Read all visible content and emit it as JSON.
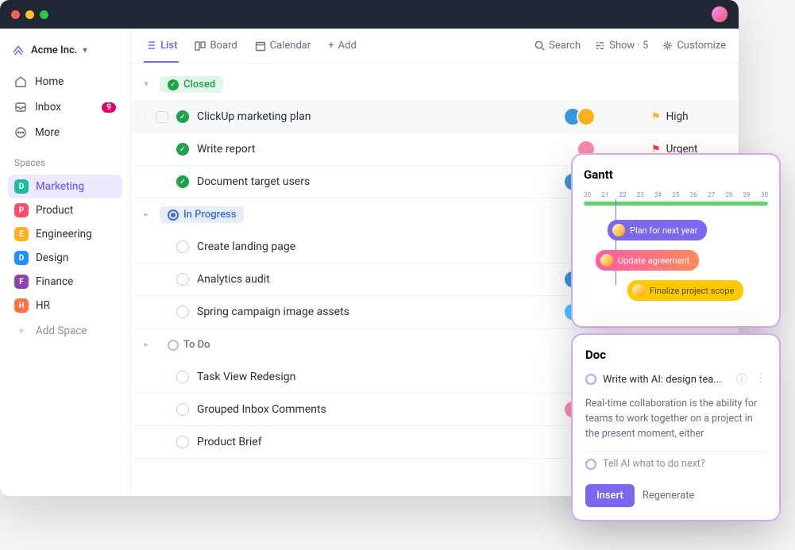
{
  "workspace": {
    "name": "Acme Inc."
  },
  "sidebar": {
    "nav": [
      {
        "label": "Home"
      },
      {
        "label": "Inbox",
        "badge": "9"
      },
      {
        "label": "More"
      }
    ],
    "spaces_label": "Spaces",
    "spaces": [
      {
        "letter": "D",
        "name": "Marketing",
        "color": "#1abc9c",
        "active": true
      },
      {
        "letter": "P",
        "name": "Product",
        "color": "#ff4d6a"
      },
      {
        "letter": "E",
        "name": "Engineering",
        "color": "#ffb020"
      },
      {
        "letter": "D",
        "name": "Design",
        "color": "#1e90ff"
      },
      {
        "letter": "F",
        "name": "Finance",
        "color": "#8e44ad"
      },
      {
        "letter": "H",
        "name": "HR",
        "color": "#ff7043"
      }
    ],
    "add_space": "Add Space"
  },
  "toolbar": {
    "views": {
      "list": "List",
      "board": "Board",
      "calendar": "Calendar",
      "add": "Add"
    },
    "search": "Search",
    "show": "Show · 5",
    "customize": "Customize"
  },
  "groups": [
    {
      "status": "Closed",
      "style": "closed",
      "tasks": [
        {
          "title": "ClickUp marketing plan",
          "status": "closed",
          "assignees": [
            "#3498db",
            "#ffb020"
          ],
          "priority": "High",
          "flag_color": "#ffb020",
          "highlighted": true
        },
        {
          "title": "Write report",
          "status": "closed",
          "assignees": [
            "#ff8aa6"
          ],
          "priority": "Urgent",
          "flag_color": "#ff3b30"
        },
        {
          "title": "Document target users",
          "status": "closed",
          "assignees": [
            "#3498db",
            "#ffb020"
          ]
        }
      ]
    },
    {
      "status": "In Progress",
      "style": "inprogress",
      "tasks": [
        {
          "title": "Create landing page",
          "status": "open",
          "assignees": [
            "#40c9ff"
          ]
        },
        {
          "title": "Analytics audit",
          "status": "open",
          "assignees": [
            "#3498db",
            "#ffb020"
          ]
        },
        {
          "title": "Spring campaign image assets",
          "status": "open",
          "assignees": [
            "#40c9ff",
            "#ffb020"
          ]
        }
      ]
    },
    {
      "status": "To Do",
      "style": "todo",
      "tasks": [
        {
          "title": "Task View Redesign",
          "status": "open",
          "assignees": [
            "#ffb020"
          ]
        },
        {
          "title": "Grouped Inbox Comments",
          "status": "open",
          "assignees": [
            "#ff8aa6",
            "#ffd28a"
          ]
        },
        {
          "title": "Product Brief",
          "status": "open",
          "assignees": [
            "#40e0d0"
          ]
        }
      ]
    }
  ],
  "gantt": {
    "title": "Gantt",
    "dates": [
      "20",
      "21",
      "22",
      "23",
      "24",
      "25",
      "26",
      "27",
      "28",
      "29",
      "30"
    ],
    "active_date_index": 2,
    "bars": [
      {
        "label": "Plan for next year"
      },
      {
        "label": "Update agreement"
      },
      {
        "label": "Finalize project scope"
      }
    ]
  },
  "doc": {
    "title": "Doc",
    "ai_title": "Write with AI: design tea...",
    "body": "Real-time collaboration is the ability for teams to work together on a project in the present moment, either",
    "prompt": "Tell AI what to do next?",
    "insert": "Insert",
    "regenerate": "Regenerate"
  }
}
